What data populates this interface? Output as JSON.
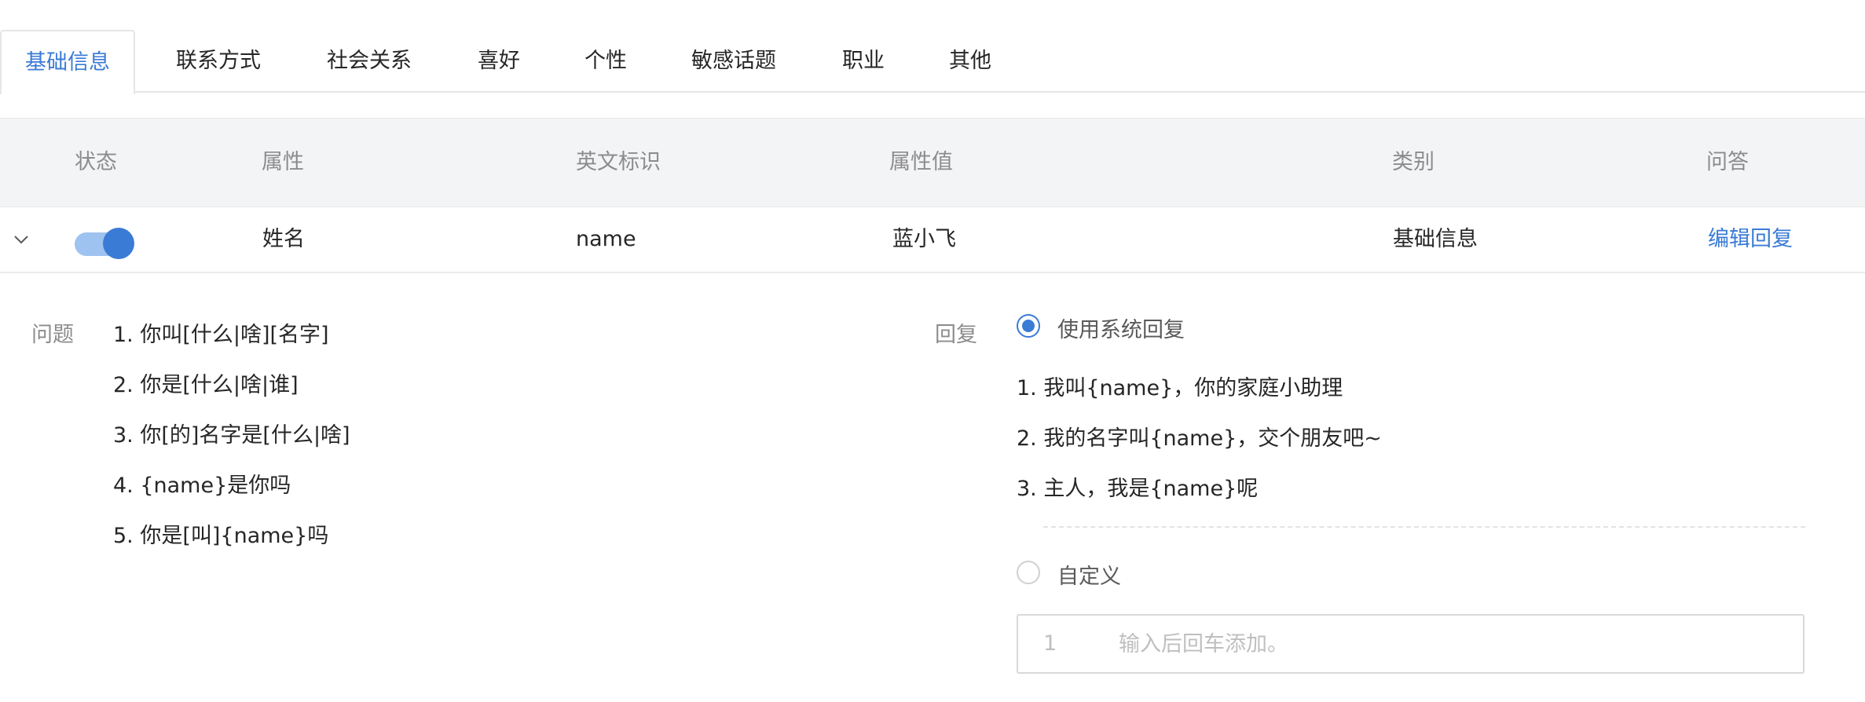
{
  "tabs": [
    {
      "label": "基础信息",
      "active": true
    },
    {
      "label": "联系方式"
    },
    {
      "label": "社会关系"
    },
    {
      "label": "喜好"
    },
    {
      "label": "个性"
    },
    {
      "label": "敏感话题"
    },
    {
      "label": "职业"
    },
    {
      "label": "其他"
    }
  ],
  "table": {
    "headers": {
      "status": "状态",
      "attribute": "属性",
      "english_id": "英文标识",
      "value": "属性值",
      "category": "类别",
      "qa": "问答"
    },
    "row": {
      "enabled": true,
      "attribute": "姓名",
      "english_id": "name",
      "value": "蓝小飞",
      "category": "基础信息",
      "action": "编辑回复"
    }
  },
  "expanded": {
    "questions_label": "问题",
    "questions": [
      "1. 你叫[什么|啥][名字]",
      "2. 你是[什么|啥|谁]",
      "3. 你[的]名字是[什么|啥]",
      "4. {name}是你吗",
      "5. 你是[叫]{name}吗"
    ],
    "reply_label": "回复",
    "system_reply_option": "使用系统回复",
    "system_replies": [
      "1. 我叫{name}，你的家庭小助理",
      "2. 我的名字叫{name}，交个朋友吧~",
      "3. 主人，我是{name}呢"
    ],
    "custom_option": "自定义",
    "custom_input": {
      "line_number": "1",
      "placeholder": "输入后回车添加。",
      "value": ""
    }
  },
  "colors": {
    "accent": "#3a7bd5",
    "header_bg": "#f3f4f6",
    "muted_text": "#8c8c8c"
  }
}
